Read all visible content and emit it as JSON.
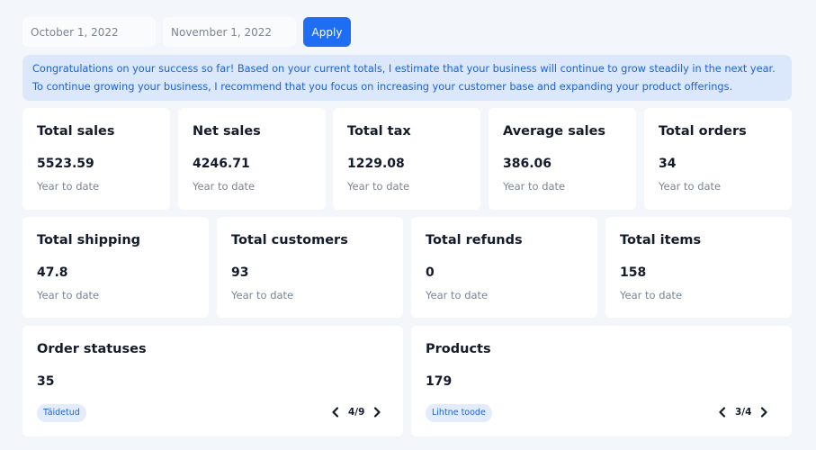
{
  "date_filter": {
    "start_date": "October 1, 2022",
    "end_date": "November 1, 2022",
    "apply_label": "Apply"
  },
  "insight": {
    "text": "Congratulations on your success so far! Based on your current totals, I estimate that your business will continue to grow steadily in the next year. To continue growing your business, I recommend that you focus on increasing your customer base and expanding your product offerings."
  },
  "stats_row1": [
    {
      "title": "Total sales",
      "value": "5523.59",
      "period": "Year to date"
    },
    {
      "title": "Net sales",
      "value": "4246.71",
      "period": "Year to date"
    },
    {
      "title": "Total tax",
      "value": "1229.08",
      "period": "Year to date"
    },
    {
      "title": "Average sales",
      "value": "386.06",
      "period": "Year to date"
    },
    {
      "title": "Total orders",
      "value": "34",
      "period": "Year to date"
    }
  ],
  "stats_row2": [
    {
      "title": "Total shipping",
      "value": "47.8",
      "period": "Year to date"
    },
    {
      "title": "Total customers",
      "value": "93",
      "period": "Year to date"
    },
    {
      "title": "Total refunds",
      "value": "0",
      "period": "Year to date"
    },
    {
      "title": "Total items",
      "value": "158",
      "period": "Year to date"
    }
  ],
  "order_statuses": {
    "title": "Order statuses",
    "value": "35",
    "badge": "Täidetud",
    "page": "4/9",
    "prev_icon": "chevron-left-icon",
    "next_icon": "chevron-right-icon"
  },
  "products": {
    "title": "Products",
    "value": "179",
    "badge": "Lihtne toode",
    "page": "3/4",
    "prev_icon": "chevron-left-icon",
    "next_icon": "chevron-right-icon"
  },
  "colors": {
    "background": "#f3f6fb",
    "accent": "#1f6df2",
    "insight_bg": "#dbe7fb",
    "insight_text": "#1c63d8"
  }
}
